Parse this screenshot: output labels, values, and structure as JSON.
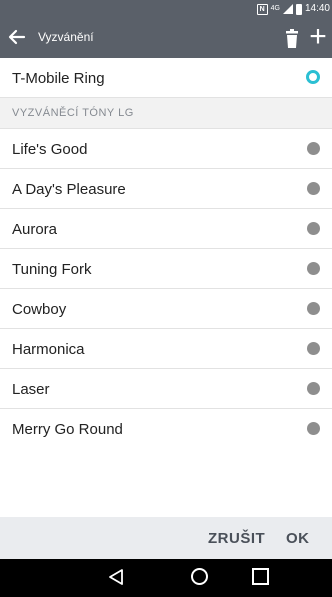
{
  "status": {
    "time": "14:40",
    "nfc": "N",
    "network": "4G"
  },
  "appbar": {
    "title": "Vyzvánění",
    "add": "+"
  },
  "current": {
    "label": "T-Mobile Ring"
  },
  "section": {
    "label": "VYZVÁNĚCÍ TÓNY LG"
  },
  "ringtones": [
    {
      "label": "Life's Good"
    },
    {
      "label": "A Day's Pleasure"
    },
    {
      "label": "Aurora"
    },
    {
      "label": "Tuning Fork"
    },
    {
      "label": "Cowboy"
    },
    {
      "label": "Harmonica"
    },
    {
      "label": "Laser"
    },
    {
      "label": "Merry Go Round"
    }
  ],
  "actions": {
    "cancel": "ZRUŠIT",
    "ok": "OK"
  },
  "colors": {
    "accent": "#2bbfd3",
    "bar": "#5a6069",
    "radio_off": "#8e8e8e"
  }
}
